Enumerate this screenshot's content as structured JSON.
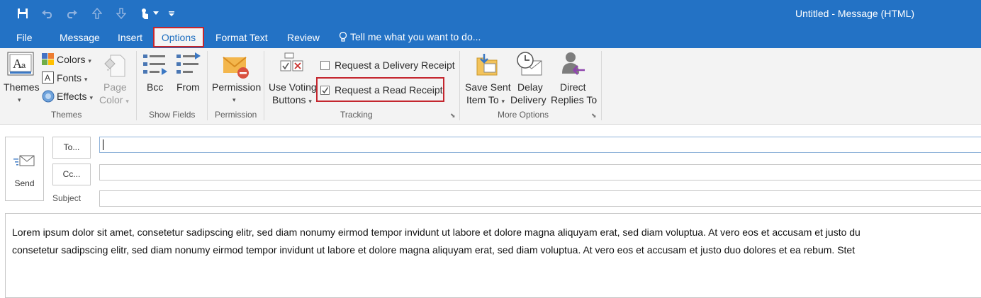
{
  "window": {
    "title": "Untitled - Message (HTML)"
  },
  "tabs": [
    {
      "label": "File"
    },
    {
      "label": "Message"
    },
    {
      "label": "Insert"
    },
    {
      "label": "Options"
    },
    {
      "label": "Format Text"
    },
    {
      "label": "Review"
    }
  ],
  "tell_me": "Tell me what you want to do...",
  "ribbon": {
    "themes_group": {
      "themes_label": "Themes",
      "colors_label": "Colors",
      "fonts_label": "Fonts",
      "effects_label": "Effects",
      "page_color_line1": "Page",
      "page_color_line2": "Color",
      "group_label": "Themes"
    },
    "show_fields_group": {
      "bcc_label": "Bcc",
      "from_label": "From",
      "group_label": "Show Fields"
    },
    "permission_group": {
      "permission_label": "Permission",
      "group_label": "Permission"
    },
    "tracking_group": {
      "voting_line1": "Use Voting",
      "voting_line2": "Buttons",
      "delivery_receipt_label": "Request a Delivery Receipt",
      "delivery_receipt_checked": false,
      "read_receipt_label": "Request a Read Receipt",
      "read_receipt_checked": true,
      "group_label": "Tracking"
    },
    "more_options_group": {
      "save_sent_line1": "Save Sent",
      "save_sent_line2": "Item To",
      "delay_line1": "Delay",
      "delay_line2": "Delivery",
      "direct_line1": "Direct",
      "direct_line2": "Replies To",
      "group_label": "More Options"
    }
  },
  "compose": {
    "send_label": "Send",
    "to_label": "To...",
    "cc_label": "Cc...",
    "subject_label": "Subject",
    "to_value": "",
    "cc_value": "",
    "subject_value": "",
    "body_lines": [
      "Lorem ipsum dolor sit amet, consetetur sadipscing elitr, sed diam nonumy eirmod tempor invidunt ut labore et dolore magna aliquyam erat, sed diam voluptua. At vero eos et accusam et justo du",
      "consetetur sadipscing elitr, sed diam nonumy eirmod tempor invidunt ut labore et dolore magna aliquyam erat, sed diam voluptua. At vero eos et accusam et justo duo dolores et ea rebum. Stet"
    ]
  },
  "colors": {
    "title_bar": "#2372c5",
    "ribbon_bg": "#f3f3f3",
    "highlight_box": "#c4262e",
    "active_tab_text": "#1e6ec0"
  }
}
